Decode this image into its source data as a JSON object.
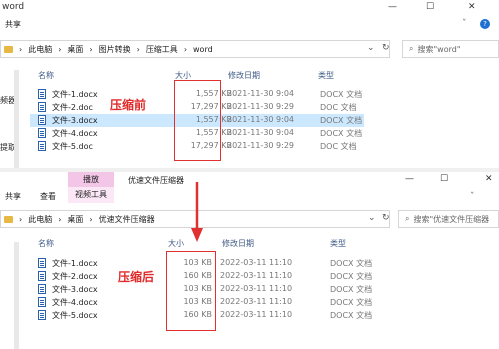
{
  "top": {
    "title": "word",
    "menu": {
      "share": "共享"
    },
    "breadcrumb": [
      "此电脑",
      "桌面",
      "图片转换",
      "压缩工具",
      "word"
    ],
    "search_placeholder": "搜索\"word\"",
    "headers": {
      "name": "名称",
      "size": "大小",
      "date": "修改日期",
      "type": "类型"
    },
    "left_labels": [
      "频器",
      "提取"
    ],
    "annotation": "压缩前",
    "rows": [
      {
        "name": "文件-1.docx",
        "size": "1,557 KB",
        "date": "2021-11-30 9:04",
        "type": "DOCX 文档"
      },
      {
        "name": "文件-2.doc",
        "size": "17,297 KB",
        "date": "2021-11-30 9:29",
        "type": "DOC 文档"
      },
      {
        "name": "文件-3.docx",
        "size": "1,557 KB",
        "date": "2021-11-30 9:04",
        "type": "DOCX 文档"
      },
      {
        "name": "文件-4.docx",
        "size": "1,557 KB",
        "date": "2021-11-30 9:04",
        "type": "DOCX 文档"
      },
      {
        "name": "文件-5.doc",
        "size": "17,297 KB",
        "date": "2021-11-30 9:29",
        "type": "DOC 文档"
      }
    ]
  },
  "bottom": {
    "ribbon_tab_play": "播放",
    "ribbon_title": "优速文件压缩器",
    "menu": {
      "share": "共享",
      "view": "查看"
    },
    "video_tools": "视频工具",
    "breadcrumb": [
      "此电脑",
      "桌面",
      "优速文件压缩器"
    ],
    "search_placeholder": "搜索\"优速文件压缩器",
    "headers": {
      "name": "名称",
      "size": "大小",
      "date": "修改日期",
      "type": "类型"
    },
    "annotation": "压缩后",
    "rows": [
      {
        "name": "文件-1.docx",
        "size": "103 KB",
        "date": "2022-03-11 11:10",
        "type": "DOCX 文档"
      },
      {
        "name": "文件-2.docx",
        "size": "160 KB",
        "date": "2022-03-11 11:10",
        "type": "DOCX 文档"
      },
      {
        "name": "文件-3.docx",
        "size": "103 KB",
        "date": "2022-03-11 11:10",
        "type": "DOCX 文档"
      },
      {
        "name": "文件-4.docx",
        "size": "103 KB",
        "date": "2022-03-11 11:10",
        "type": "DOCX 文档"
      },
      {
        "name": "文件-5.docx",
        "size": "160 KB",
        "date": "2022-03-11 11:10",
        "type": "DOCX 文档"
      }
    ]
  },
  "colors": {
    "highlight": "#e03030",
    "selected_row": "#cce8ff",
    "ribbon_play": "#f3c6e8"
  },
  "icons": {
    "window_min": "—",
    "window_max": "☐",
    "window_close": "✕",
    "expand": "ˇ",
    "help": "?",
    "search": "⌕",
    "refresh": "↻",
    "dropdown": "⌄",
    "folder": "folder-icon",
    "file": "word-file-icon"
  }
}
